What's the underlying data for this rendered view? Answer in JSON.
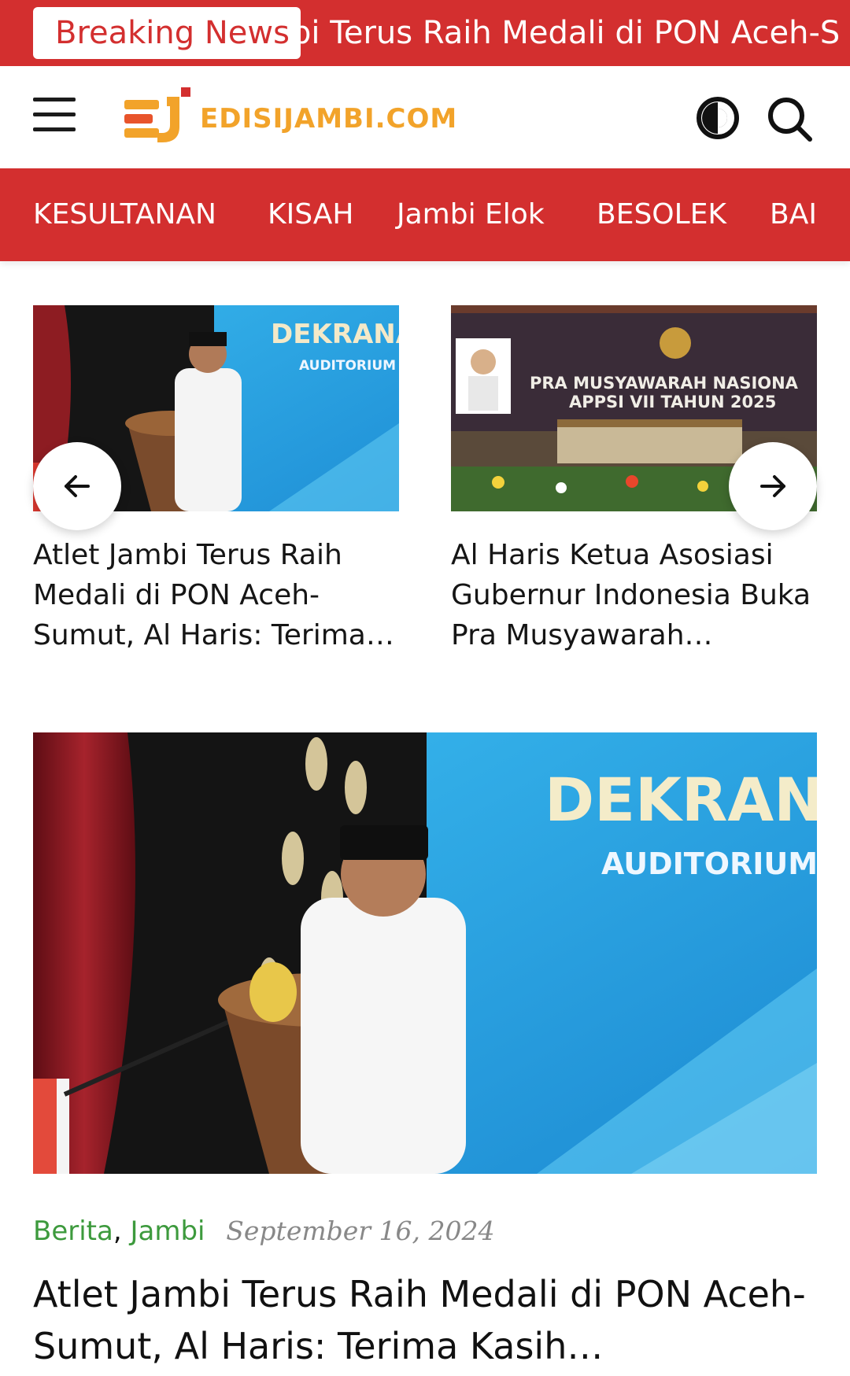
{
  "ticker": {
    "label": "Breaking News",
    "headline": "bi Terus Raih Medali di PON Aceh-S"
  },
  "header": {
    "logo_text": "EDISIJAMBI",
    "logo_suffix": ".COM",
    "icons": [
      "menu-icon",
      "contrast-toggle-icon",
      "search-icon"
    ]
  },
  "nav": {
    "items": [
      {
        "label": "KESULTANAN"
      },
      {
        "label": "KISAH"
      },
      {
        "label": "Jambi Elok"
      },
      {
        "label": "BESOLEK"
      },
      {
        "label": "BAI"
      }
    ]
  },
  "carousel": {
    "cards": [
      {
        "title": "Atlet Jambi Terus Raih Medali di PON Aceh-Sumut, Al Haris: Terima…",
        "image_text": "DEKRANA",
        "image_subtext": "AUDITORIUM"
      },
      {
        "title": "Al Haris Ketua Asosiasi Gubernur Indonesia Buka Pra Musyawarah…",
        "image_text": "PRA MUSYAWARAH NASIONA",
        "image_subtext": "APPSI VII TAHUN 2025"
      }
    ]
  },
  "featured": {
    "image_text": "DEKRANA",
    "image_subtext": "AUDITORIUM",
    "categories": [
      "Berita",
      "Jambi"
    ],
    "separator": ",",
    "date": "September 16, 2024",
    "title": "Atlet Jambi Terus Raih Medali di PON Aceh-Sumut, Al Haris: Terima Kasih…"
  },
  "colors": {
    "brand_red": "#d32f2f",
    "logo_orange": "#f2a32a",
    "category_green": "#3d9a3d"
  }
}
